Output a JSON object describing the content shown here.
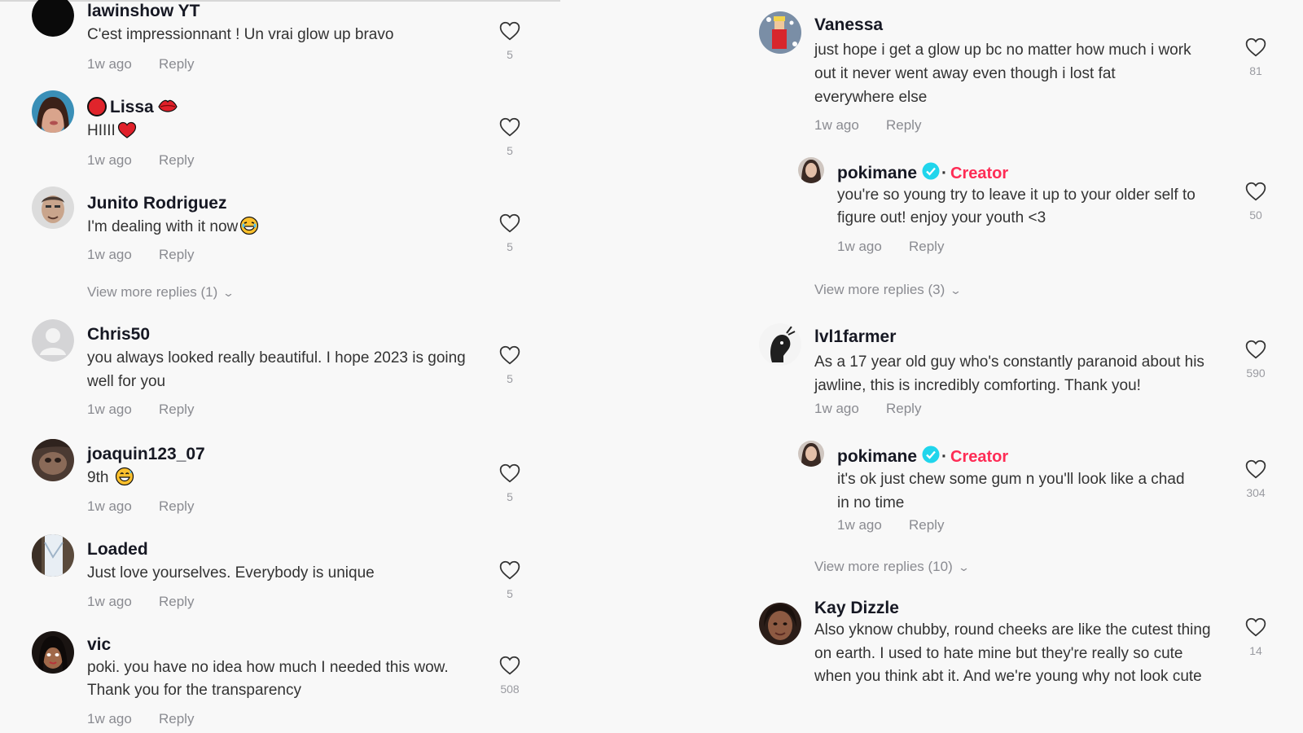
{
  "left_comments": [
    {
      "username": "lawinshow YT",
      "text": "C'est impressionnant ! Un vrai glow up bravo",
      "time": "1w ago",
      "reply_label": "Reply",
      "likes": "5"
    },
    {
      "username": "Lissa",
      "text": "HIIII",
      "time": "1w ago",
      "reply_label": "Reply",
      "likes": "5"
    },
    {
      "username": "Junito Rodriguez",
      "text": "I'm dealing with it now",
      "time": "1w ago",
      "reply_label": "Reply",
      "likes": "5",
      "view_more": "View more replies (1)"
    },
    {
      "username": "Chris50",
      "text": "you always looked really beautiful. I hope 2023 is going well for you",
      "time": "1w ago",
      "reply_label": "Reply",
      "likes": "5"
    },
    {
      "username": "joaquin123_07",
      "text": "9th",
      "time": "1w ago",
      "reply_label": "Reply",
      "likes": "5"
    },
    {
      "username": "Loaded",
      "text": "Just love yourselves. Everybody is unique",
      "time": "1w ago",
      "reply_label": "Reply",
      "likes": "5"
    },
    {
      "username": "vic",
      "text": "poki. you have no idea how much I needed this wow. Thank you for the transparency",
      "time": "1w ago",
      "reply_label": "Reply",
      "likes": "508"
    }
  ],
  "right_comments": [
    {
      "username": "Vanessa",
      "text": "just hope i get a glow up bc no matter how much i work out it never went away even though i lost fat everywhere else",
      "time": "1w ago",
      "reply_label": "Reply",
      "likes": "81",
      "reply": {
        "username": "pokimane",
        "badge": "Creator",
        "text": "you're so young  try to leave it up to your older self to figure out! enjoy your youth <3",
        "time": "1w ago",
        "reply_label": "Reply",
        "likes": "50"
      },
      "view_more": "View more replies (3)"
    },
    {
      "username": "lvl1farmer",
      "text": "As a 17 year old guy who's constantly paranoid about his jawline, this is incredibly comforting. Thank you!",
      "time": "1w ago",
      "reply_label": "Reply",
      "likes": "590",
      "reply": {
        "username": "pokimane",
        "badge": "Creator",
        "text": "it's ok just chew some gum n you'll look like a chad in no time",
        "time": "1w ago",
        "reply_label": "Reply",
        "likes": "304"
      },
      "view_more": "View more replies (10)"
    },
    {
      "username": "Kay Dizzle",
      "text": "Also yknow chubby, round cheeks are like the cutest thing on earth. I used to hate mine but they're really so cute when you think abt it. And we're young why not look cute",
      "likes": "14"
    }
  ],
  "colors": {
    "creator": "#fe2c55",
    "verified": "#20d5ec",
    "muted": "#8a8b91"
  }
}
